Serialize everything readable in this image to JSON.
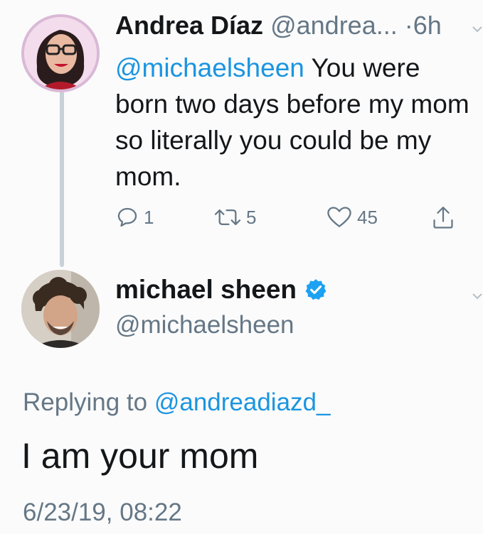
{
  "tweet1": {
    "author_name": "Andrea Díaz",
    "author_handle": "@andrea...",
    "separator": "·",
    "time": "6h",
    "mention": "@michaelsheen",
    "text": " You were born two days before my mom so literally you could be my mom.",
    "reply_count": "1",
    "retweet_count": "5",
    "like_count": "45",
    "caret_icon": "chevron-down-icon"
  },
  "tweet2": {
    "author_name": "michael sheen",
    "author_handle": "@michaelsheen",
    "verified_icon": "verified-badge-icon",
    "replying_label": "Replying to ",
    "replying_to": "@andreadiazd_",
    "text": "I am your mom",
    "timestamp": "6/23/19, 08:22"
  },
  "colors": {
    "link": "#1b95e0",
    "secondary_text": "#657786",
    "primary_text": "#14171a",
    "thread_line": "#c7d1d8",
    "verified": "#1da1f2"
  }
}
